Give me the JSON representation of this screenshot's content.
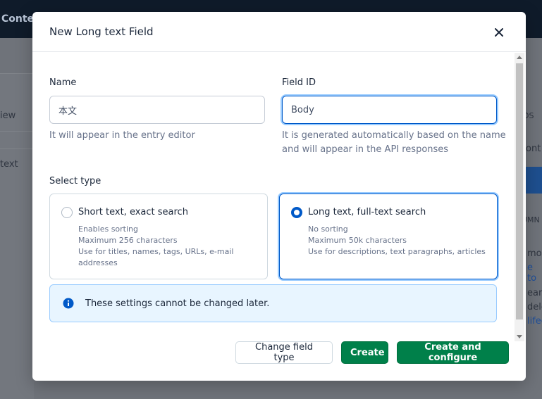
{
  "background": {
    "app_name_fragment": "Conte",
    "left_labels": [
      "iew",
      "text"
    ],
    "right_labels": [
      "DS",
      "ont",
      "UMN",
      "mo",
      "e to",
      "earn",
      "dele",
      "lifec"
    ]
  },
  "dialog": {
    "title": "New Long text Field",
    "name": {
      "label": "Name",
      "value": "本文",
      "help": "It will appear in the entry editor"
    },
    "field_id": {
      "label": "Field ID",
      "value": "Body",
      "help_line1": "It is generated automatically based on the name",
      "help_line2": "and will appear in the API responses"
    },
    "select_type_label": "Select type",
    "types": [
      {
        "title": "Short text, exact search",
        "lines": [
          "Enables sorting",
          "Maximum 256 characters",
          "Use for titles, names, tags, URLs, e-mail addresses"
        ],
        "selected": false
      },
      {
        "title": "Long text, full-text search",
        "lines": [
          "No sorting",
          "Maximum 50k characters",
          "Use for descriptions, text paragraphs, articles"
        ],
        "selected": true
      }
    ],
    "notice": "These settings cannot be changed later.",
    "buttons": {
      "change_type": "Change field type",
      "create": "Create",
      "create_configure": "Create and configure"
    }
  },
  "colors": {
    "accent": "#0059c8",
    "positive": "#00804a",
    "notice_bg": "#e8f5ff"
  },
  "icons": {
    "close": "close-icon",
    "info": "info-icon"
  }
}
